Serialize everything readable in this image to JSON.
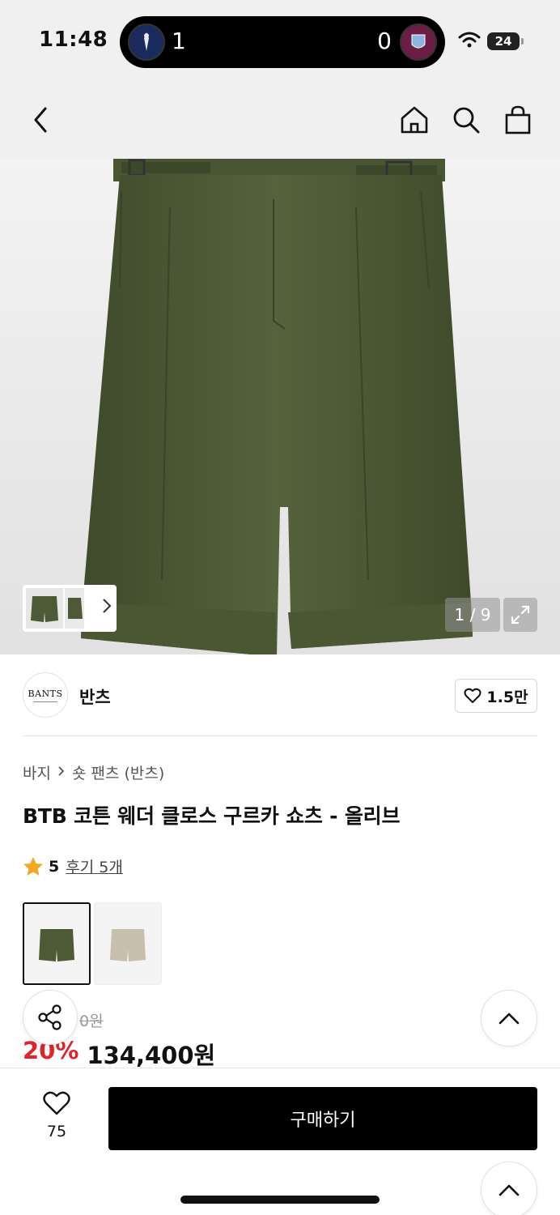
{
  "status_bar": {
    "time": "11:48",
    "live_activity": {
      "home_score": "1",
      "away_score": "0"
    },
    "battery": "24"
  },
  "nav": {
    "back_icon": "chevron-left-icon",
    "home_icon": "home-icon",
    "search_icon": "search-icon",
    "cart_icon": "shopping-bag-icon"
  },
  "gallery": {
    "counter": "1 / 9",
    "product_color": "#4e5a36"
  },
  "brand": {
    "logo_text": "BANTS",
    "name": "반츠",
    "likes": "1.5만"
  },
  "product": {
    "breadcrumb": [
      "바지",
      "숏 팬츠 (반츠)"
    ],
    "title": "BTB 코튼 웨더 클로스 구르카 쇼츠 - 올리브",
    "rating": "5",
    "reviews": "후기 5개",
    "swatches": [
      {
        "name": "olive",
        "color": "#4e5a36"
      },
      {
        "name": "beige",
        "color": "#c9bfae"
      }
    ],
    "price_original": "0원",
    "discount": "20%",
    "price": "134,400원"
  },
  "bottom_bar": {
    "wish_count": "75",
    "buy_label": "구매하기"
  },
  "colors": {
    "accent_discount": "#e2232a",
    "star": "#f5a623",
    "buy_button": "#000000"
  }
}
